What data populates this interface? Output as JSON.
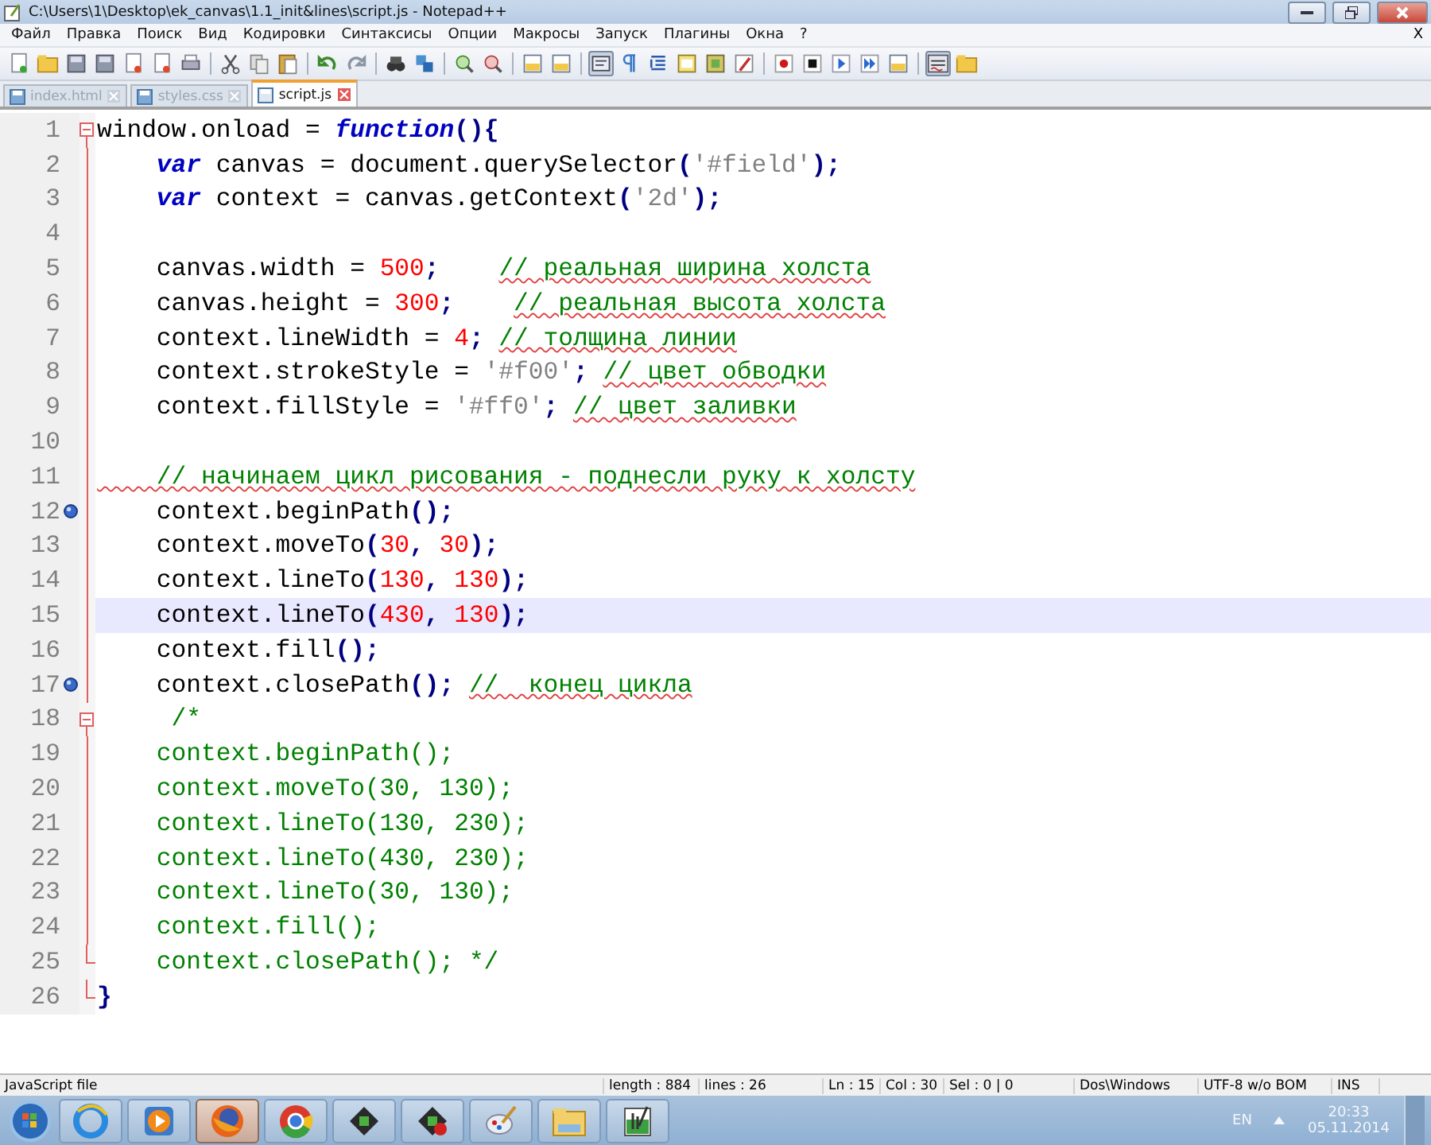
{
  "window": {
    "title": "C:\\Users\\1\\Desktop\\ek_canvas\\1.1_init&lines\\script.js - Notepad++"
  },
  "menu": {
    "items": [
      "Файл",
      "Правка",
      "Поиск",
      "Вид",
      "Кодировки",
      "Синтаксисы",
      "Опции",
      "Макросы",
      "Запуск",
      "Плагины",
      "Окна",
      "?"
    ],
    "close": "X"
  },
  "tabs": [
    {
      "label": "index.html",
      "selected": false
    },
    {
      "label": "styles.css",
      "selected": false
    },
    {
      "label": "script.js",
      "selected": true
    }
  ],
  "lines": [
    {
      "number": "1",
      "bookmark": false,
      "current": false,
      "fold_open": true,
      "fold_end": false,
      "tokens": [
        {
          "kind": "text",
          "text": "window.onload = "
        },
        {
          "kind": "keyword",
          "text": "function"
        },
        {
          "kind": "op",
          "text": "(){"
        }
      ]
    },
    {
      "number": "2",
      "bookmark": false,
      "current": false,
      "fold_open": false,
      "fold_end": false,
      "tokens": [
        {
          "kind": "keyword",
          "text": "    var"
        },
        {
          "kind": "text",
          "text": " canvas = document.querySelector"
        },
        {
          "kind": "op",
          "text": "("
        },
        {
          "kind": "string",
          "text": "'#field'"
        },
        {
          "kind": "op",
          "text": ");"
        }
      ]
    },
    {
      "number": "3",
      "bookmark": false,
      "current": false,
      "fold_open": false,
      "fold_end": false,
      "tokens": [
        {
          "kind": "keyword",
          "text": "    var"
        },
        {
          "kind": "text",
          "text": " context = canvas.getContext"
        },
        {
          "kind": "op",
          "text": "("
        },
        {
          "kind": "string",
          "text": "'2d'"
        },
        {
          "kind": "op",
          "text": ");"
        }
      ]
    },
    {
      "number": "4",
      "bookmark": false,
      "current": false,
      "fold_open": false,
      "fold_end": false
    },
    {
      "number": "5",
      "bookmark": false,
      "current": false,
      "fold_open": false,
      "fold_end": false,
      "tokens": [
        {
          "kind": "text",
          "text": "    canvas.width = "
        },
        {
          "kind": "number",
          "text": "500"
        },
        {
          "kind": "op",
          "text": ";    "
        },
        {
          "kind": "comment",
          "text": "// реальная ширина холста",
          "misspelled": true
        }
      ]
    },
    {
      "number": "6",
      "bookmark": false,
      "current": false,
      "fold_open": false,
      "fold_end": false,
      "tokens": [
        {
          "kind": "text",
          "text": "    canvas.height = "
        },
        {
          "kind": "number",
          "text": "300"
        },
        {
          "kind": "op",
          "text": ";    "
        },
        {
          "kind": "comment",
          "text": "// реальная высота холста",
          "misspelled": true
        }
      ]
    },
    {
      "number": "7",
      "bookmark": false,
      "current": false,
      "fold_open": false,
      "fold_end": false,
      "tokens": [
        {
          "kind": "text",
          "text": "    context.lineWidth = "
        },
        {
          "kind": "number",
          "text": "4"
        },
        {
          "kind": "op",
          "text": "; "
        },
        {
          "kind": "comment",
          "text": "// толщина линии",
          "misspelled": true
        }
      ]
    },
    {
      "number": "8",
      "bookmark": false,
      "current": false,
      "fold_open": false,
      "fold_end": false,
      "tokens": [
        {
          "kind": "text",
          "text": "    context.strokeStyle = "
        },
        {
          "kind": "string",
          "text": "'#f00'"
        },
        {
          "kind": "op",
          "text": "; "
        },
        {
          "kind": "comment",
          "text": "// цвет обводки",
          "misspelled": true
        }
      ]
    },
    {
      "number": "9",
      "bookmark": false,
      "current": false,
      "fold_open": false,
      "fold_end": false,
      "tokens": [
        {
          "kind": "text",
          "text": "    context.fillStyle = "
        },
        {
          "kind": "string",
          "text": "'#ff0'"
        },
        {
          "kind": "op",
          "text": "; "
        },
        {
          "kind": "comment",
          "text": "// цвет заливки",
          "misspelled": true
        }
      ]
    },
    {
      "number": "10",
      "bookmark": false,
      "current": false,
      "fold_open": false,
      "fold_end": false
    },
    {
      "number": "11",
      "bookmark": false,
      "current": false,
      "fold_open": false,
      "fold_end": false,
      "tokens": [
        {
          "kind": "comment",
          "text": "    // начинаем цикл рисования - поднесли руку к холсту",
          "misspelled": true
        }
      ]
    },
    {
      "number": "12",
      "bookmark": true,
      "current": false,
      "fold_open": false,
      "fold_end": false,
      "tokens": [
        {
          "kind": "text",
          "text": "    context.beginPath"
        },
        {
          "kind": "op",
          "text": "();"
        }
      ]
    },
    {
      "number": "13",
      "bookmark": false,
      "current": false,
      "fold_open": false,
      "fold_end": false,
      "tokens": [
        {
          "kind": "text",
          "text": "    context.moveTo"
        },
        {
          "kind": "op",
          "text": "("
        },
        {
          "kind": "number",
          "text": "30"
        },
        {
          "kind": "op",
          "text": ", "
        },
        {
          "kind": "number",
          "text": "30"
        },
        {
          "kind": "op",
          "text": ");"
        }
      ]
    },
    {
      "number": "14",
      "bookmark": false,
      "current": false,
      "fold_open": false,
      "fold_end": false,
      "tokens": [
        {
          "kind": "text",
          "text": "    context.lineTo"
        },
        {
          "kind": "op",
          "text": "("
        },
        {
          "kind": "number",
          "text": "130"
        },
        {
          "kind": "op",
          "text": ", "
        },
        {
          "kind": "number",
          "text": "130"
        },
        {
          "kind": "op",
          "text": ");"
        }
      ]
    },
    {
      "number": "15",
      "bookmark": false,
      "current": true,
      "fold_open": false,
      "fold_end": false,
      "tokens": [
        {
          "kind": "text",
          "text": "    context.lineTo"
        },
        {
          "kind": "op",
          "text": "("
        },
        {
          "kind": "number",
          "text": "430"
        },
        {
          "kind": "op",
          "text": ", "
        },
        {
          "kind": "number",
          "text": "130"
        },
        {
          "kind": "op",
          "text": ");"
        }
      ]
    },
    {
      "number": "16",
      "bookmark": false,
      "current": false,
      "fold_open": false,
      "fold_end": false,
      "tokens": [
        {
          "kind": "text",
          "text": "    context.fill"
        },
        {
          "kind": "op",
          "text": "();"
        }
      ]
    },
    {
      "number": "17",
      "bookmark": true,
      "current": false,
      "fold_open": false,
      "fold_end": false,
      "tokens": [
        {
          "kind": "text",
          "text": "    context.closePath"
        },
        {
          "kind": "op",
          "text": "(); "
        },
        {
          "kind": "comment",
          "text": "//  конец цикла",
          "misspelled": true
        }
      ]
    },
    {
      "number": "18",
      "bookmark": false,
      "current": false,
      "fold_open": true,
      "fold_end": false,
      "tokens": [
        {
          "kind": "comment",
          "text": "     /*"
        }
      ]
    },
    {
      "number": "19",
      "bookmark": false,
      "current": false,
      "fold_open": false,
      "fold_end": false,
      "tokens": [
        {
          "kind": "comment",
          "text": "    context.beginPath();"
        }
      ]
    },
    {
      "number": "20",
      "bookmark": false,
      "current": false,
      "fold_open": false,
      "fold_end": false,
      "tokens": [
        {
          "kind": "comment",
          "text": "    context.moveTo(30, 130);"
        }
      ]
    },
    {
      "number": "21",
      "bookmark": false,
      "current": false,
      "fold_open": false,
      "fold_end": false,
      "tokens": [
        {
          "kind": "comment",
          "text": "    context.lineTo(130, 230);"
        }
      ]
    },
    {
      "number": "22",
      "bookmark": false,
      "current": false,
      "fold_open": false,
      "fold_end": false,
      "tokens": [
        {
          "kind": "comment",
          "text": "    context.lineTo(430, 230);"
        }
      ]
    },
    {
      "number": "23",
      "bookmark": false,
      "current": false,
      "fold_open": false,
      "fold_end": false,
      "tokens": [
        {
          "kind": "comment",
          "text": "    context.lineTo(30, 130);"
        }
      ]
    },
    {
      "number": "24",
      "bookmark": false,
      "current": false,
      "fold_open": false,
      "fold_end": false,
      "tokens": [
        {
          "kind": "comment",
          "text": "    context.fill();"
        }
      ]
    },
    {
      "number": "25",
      "bookmark": false,
      "current": false,
      "fold_open": false,
      "fold_end": true,
      "tokens": [
        {
          "kind": "comment",
          "text": "    context.closePath(); */"
        }
      ]
    },
    {
      "number": "26",
      "bookmark": false,
      "current": false,
      "fold_open": false,
      "fold_end": true,
      "tokens": [
        {
          "kind": "op",
          "text": "}"
        }
      ]
    }
  ],
  "status_bar": {
    "file_type": "JavaScript file",
    "length": "length : 884",
    "lines": "lines : 26",
    "position": "Ln : 15",
    "column": "Col : 30",
    "selection": "Sel : 0 | 0",
    "eol": "Dos\\Windows",
    "encoding": "UTF-8 w/o BOM",
    "mode": "INS"
  },
  "taskbar": {
    "apps": [
      {
        "kind": "ie",
        "selected": false
      },
      {
        "kind": "media",
        "selected": false
      },
      {
        "kind": "firefox",
        "selected": true
      },
      {
        "kind": "chrome",
        "selected": false
      },
      {
        "kind": "terminal",
        "selected": false
      },
      {
        "kind": "terminal-stop",
        "selected": false
      },
      {
        "kind": "paint",
        "selected": false
      },
      {
        "kind": "explorer",
        "selected": false
      },
      {
        "kind": "notepad",
        "selected": false
      }
    ],
    "tray": {
      "language": "EN",
      "time": "20:33",
      "date": "05.11.2014"
    }
  }
}
